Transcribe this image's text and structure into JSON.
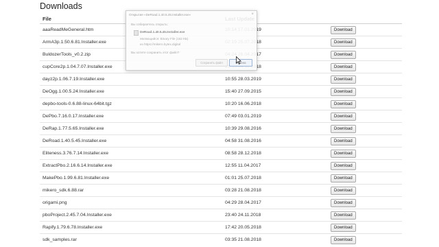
{
  "page": {
    "title": "Downloads"
  },
  "table": {
    "headers": {
      "file": "File",
      "last_update": "Last Update"
    },
    "rows": [
      {
        "file": "aaaReadMeGeneral.htm",
        "date": "10:14 17.01.2019",
        "action": "Download"
      },
      {
        "file": "ArmA3p.1.50.6.81.Installer.exe",
        "date": "02:19 25.07.2018",
        "action": "Download"
      },
      {
        "file": "BuldozerTools_v0.2.zip",
        "date": "04:24 26.04.2017",
        "action": "Download"
      },
      {
        "file": "cupCore2p.1.04.7.07.Installer.exe",
        "date": "21:33 04.12.2018",
        "action": "Download"
      },
      {
        "file": "dayz2p.1.06.7.19.Installer.exe",
        "date": "10:55 28.03.2019",
        "action": "Download"
      },
      {
        "file": "DeOgg.1.00.5.24.Installer.exe",
        "date": "15:40 27.09.2015",
        "action": "Download"
      },
      {
        "file": "depbo-tools-0.6.88-linux-64bit.tgz",
        "date": "10:20 16.06.2018",
        "action": "Download"
      },
      {
        "file": "DePbo.7.16.0.17.Installer.exe",
        "date": "07:49 03.01.2019",
        "action": "Download"
      },
      {
        "file": "DeRap.1.77.5.65.Installer.exe",
        "date": "10:39 29.08.2016",
        "action": "Download"
      },
      {
        "file": "DeRoad.1.40.5.45.Installer.exe",
        "date": "04:58 31.08.2016",
        "action": "Download"
      },
      {
        "file": "Eliteness.3.76.7.14.Installer.exe",
        "date": "08:58 28.12.2018",
        "action": "Download"
      },
      {
        "file": "ExtractPbo.2.16.6.14.Installer.exe",
        "date": "12:55 11.04.2017",
        "action": "Download"
      },
      {
        "file": "MakePbo.1.99.6.81.Installer.exe",
        "date": "01:01 25.07.2018",
        "action": "Download"
      },
      {
        "file": "mikero_sdk.6.88.rar",
        "date": "03:28 21.08.2018",
        "action": "Download"
      },
      {
        "file": "origami.png",
        "date": "04:29 28.04.2017",
        "action": "Download"
      },
      {
        "file": "pboProject.2.45.7.04.Installer.exe",
        "date": "23:40 24.11.2018",
        "action": "Download"
      },
      {
        "file": "Rapify.1.79.6.78.Installer.exe",
        "date": "17:42 20.05.2018",
        "action": "Download"
      },
      {
        "file": "sdk_samples.rar",
        "date": "03:35 21.08.2018",
        "action": "Download"
      }
    ]
  },
  "dialog": {
    "title": "Открытие «DeRoad.1.40.5.45.Installer.exe»",
    "close": "×",
    "intro": "Вы собираетесь открыть:",
    "filename": "DeRoad.1.40.5.45.Installer.exe",
    "type_row": "являющийся:  Binary File (162 КБ)",
    "from_row": "из  https://mikero.bytex.digital",
    "question": "Вы хотите сохранить этот файл?",
    "save_label": "Сохранить файл",
    "cancel_label": "Отмена"
  }
}
